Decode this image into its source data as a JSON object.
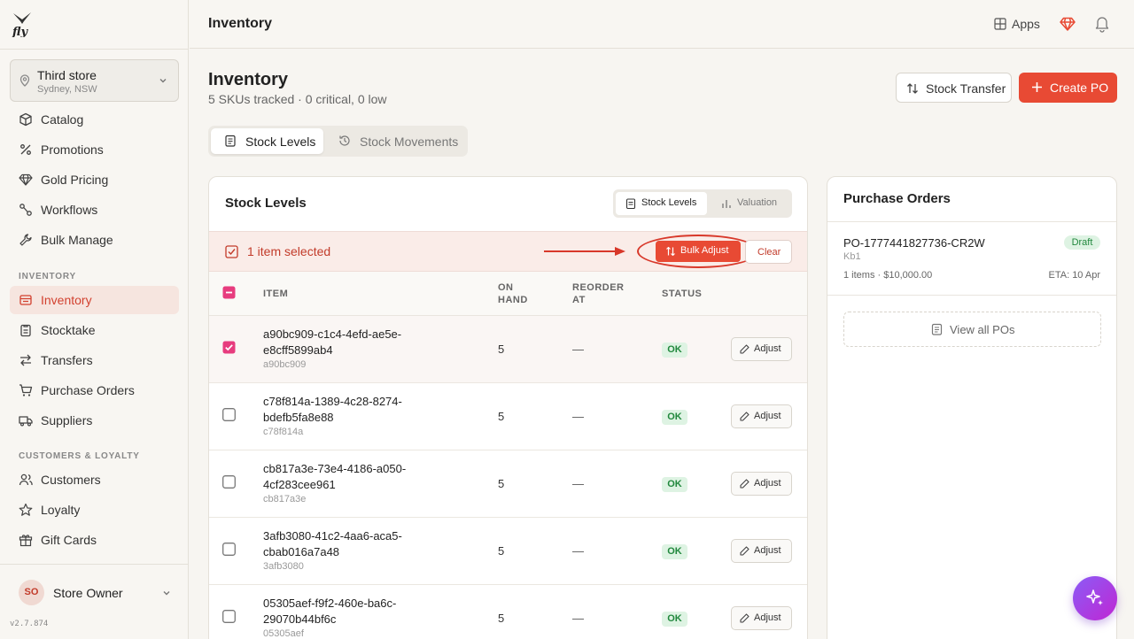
{
  "sidebar": {
    "store": {
      "name": "Third store",
      "location": "Sydney, NSW"
    },
    "nav_top": [
      {
        "label": "Catalog",
        "icon": "box-icon"
      },
      {
        "label": "Promotions",
        "icon": "percent-icon"
      },
      {
        "label": "Gold Pricing",
        "icon": "gem-icon"
      },
      {
        "label": "Workflows",
        "icon": "workflow-icon"
      },
      {
        "label": "Bulk Manage",
        "icon": "wrench-icon"
      }
    ],
    "section_inventory": "INVENTORY",
    "nav_inventory": [
      {
        "label": "Inventory",
        "icon": "inventory-icon",
        "active": true
      },
      {
        "label": "Stocktake",
        "icon": "clipboard-icon"
      },
      {
        "label": "Transfers",
        "icon": "transfer-icon"
      },
      {
        "label": "Purchase Orders",
        "icon": "cart-icon"
      },
      {
        "label": "Suppliers",
        "icon": "truck-icon"
      }
    ],
    "section_customers": "CUSTOMERS & LOYALTY",
    "nav_customers": [
      {
        "label": "Customers",
        "icon": "users-icon"
      },
      {
        "label": "Loyalty",
        "icon": "star-icon"
      },
      {
        "label": "Gift Cards",
        "icon": "gift-icon"
      }
    ],
    "user": {
      "initials": "SO",
      "name": "Store Owner"
    },
    "version": "v2.7.874"
  },
  "topbar": {
    "title": "Inventory",
    "apps_label": "Apps"
  },
  "page": {
    "title": "Inventory",
    "subtitle": "5 SKUs tracked · 0 critical, 0 low",
    "stock_transfer_label": "Stock Transfer",
    "create_po_label": "Create PO"
  },
  "tabs": [
    {
      "label": "Stock Levels",
      "active": true
    },
    {
      "label": "Stock Movements",
      "active": false
    }
  ],
  "stock_card": {
    "title": "Stock Levels",
    "segments": [
      {
        "label": "Stock Levels",
        "active": true
      },
      {
        "label": "Valuation",
        "active": false
      }
    ],
    "selection": {
      "label": "1 item selected",
      "bulk_adjust_label": "Bulk Adjust",
      "clear_label": "Clear"
    },
    "columns": {
      "item": "ITEM",
      "on_hand_1": "ON",
      "on_hand_2": "HAND",
      "reorder_1": "REORDER",
      "reorder_2": "AT",
      "status": "STATUS"
    },
    "adjust_label": "Adjust",
    "rows": [
      {
        "name": "a90bc909-c1c4-4efd-ae5e-e8cff5899ab4",
        "sku": "a90bc909",
        "on_hand": "5",
        "reorder": "—",
        "status": "OK",
        "selected": true
      },
      {
        "name": "c78f814a-1389-4c28-8274-bdefb5fa8e88",
        "sku": "c78f814a",
        "on_hand": "5",
        "reorder": "—",
        "status": "OK",
        "selected": false
      },
      {
        "name": "cb817a3e-73e4-4186-a050-4cf283cee961",
        "sku": "cb817a3e",
        "on_hand": "5",
        "reorder": "—",
        "status": "OK",
        "selected": false
      },
      {
        "name": "3afb3080-41c2-4aa6-aca5-cbab016a7a48",
        "sku": "3afb3080",
        "on_hand": "5",
        "reorder": "—",
        "status": "OK",
        "selected": false
      },
      {
        "name": "05305aef-f9f2-460e-ba6c-29070b44bf6c",
        "sku": "05305aef",
        "on_hand": "5",
        "reorder": "—",
        "status": "OK",
        "selected": false
      }
    ]
  },
  "po_card": {
    "title": "Purchase Orders",
    "order": {
      "number": "PO-1777441827736-CR2W",
      "status": "Draft",
      "supplier": "Kb1",
      "meta": "1 items · $10,000.00",
      "eta": "ETA: 10 Apr"
    },
    "view_all_label": "View all POs"
  },
  "colors": {
    "accent": "#e84a34",
    "active_nav_bg": "#f6e5df",
    "status_ok": "#21883d",
    "fab_gradient_start": "#8b5cf6",
    "fab_gradient_end": "#c026d3"
  }
}
